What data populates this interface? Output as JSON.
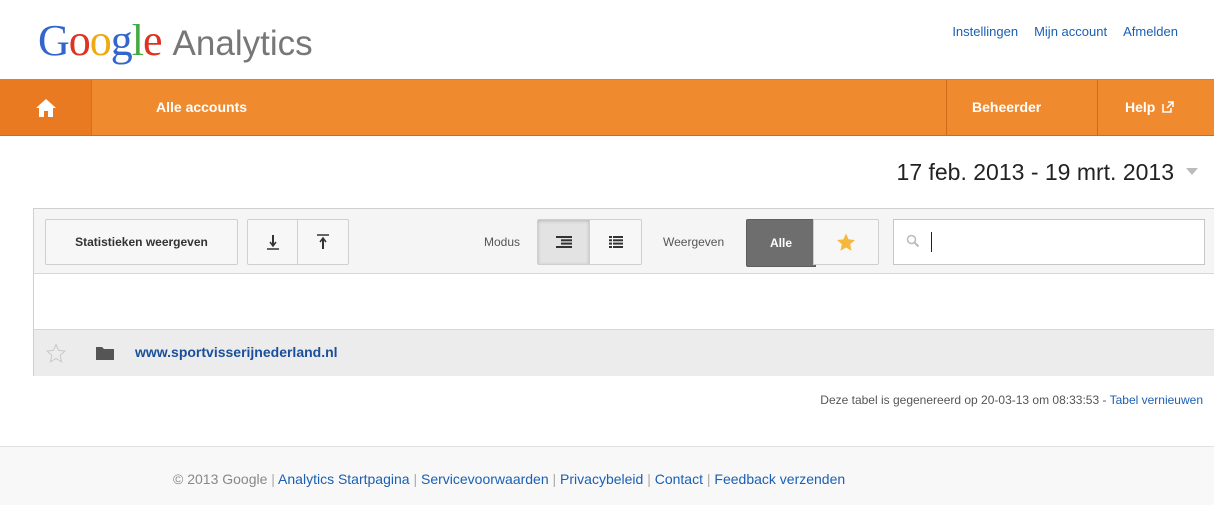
{
  "logo": {
    "letters": [
      {
        "ch": "G",
        "color": "#3366cc"
      },
      {
        "ch": "o",
        "color": "#dd3322"
      },
      {
        "ch": "o",
        "color": "#eeaa11"
      },
      {
        "ch": "g",
        "color": "#3366cc"
      },
      {
        "ch": "l",
        "color": "#44aa44"
      },
      {
        "ch": "e",
        "color": "#dd3322"
      }
    ],
    "product": "Analytics"
  },
  "header": {
    "links": [
      "Instellingen",
      "Mijn account",
      "Afmelden"
    ]
  },
  "navbar": {
    "home_icon": "home-icon",
    "accounts_label": "Alle accounts",
    "admin_label": "Beheerder",
    "help_label": "Help",
    "help_icon": "external-link-icon",
    "color": "#f08a2e"
  },
  "date_range": "17 feb. 2013 - 19 mrt. 2013",
  "toolbar": {
    "stats_button": "Statistieken weergeven",
    "modus_label": "Modus",
    "weergeven_label": "Weergeven",
    "alle_button": "Alle",
    "search_value": ""
  },
  "accounts": [
    {
      "name": "www.sportvisserijnederland.nl",
      "starred": false
    }
  ],
  "generated": {
    "text": "Deze tabel is gegenereerd op 20-03-13 om 08:33:53 - ",
    "refresh_link": "Tabel vernieuwen"
  },
  "footer": {
    "copyright": "© 2013 Google",
    "links": [
      "Analytics Startpagina",
      "Servicevoorwaarden",
      "Privacybeleid",
      "Contact",
      "Feedback verzenden"
    ]
  }
}
